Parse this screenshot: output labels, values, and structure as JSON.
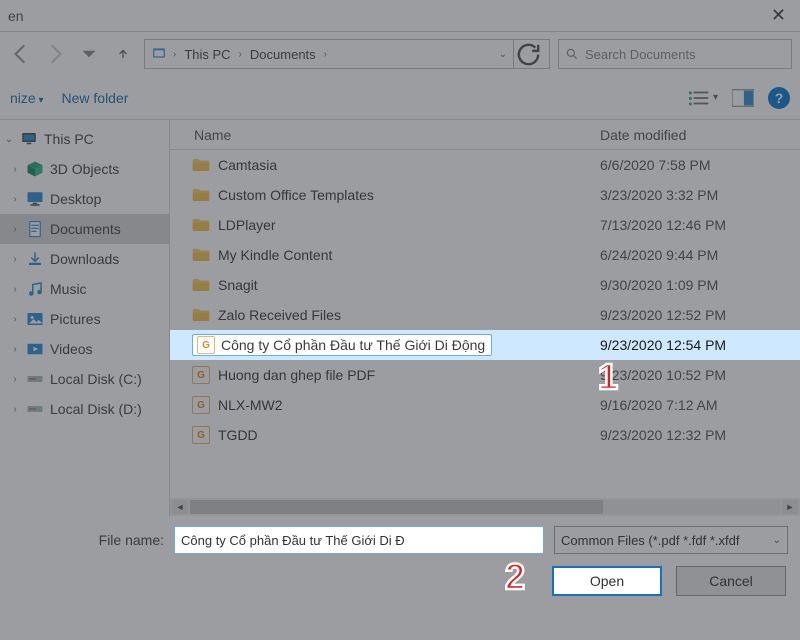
{
  "title": "en",
  "breadcrumb": {
    "items": [
      "This PC",
      "Documents"
    ]
  },
  "search": {
    "placeholder": "Search Documents"
  },
  "toolbar": {
    "organize": "nize",
    "newFolder": "New folder"
  },
  "columns": {
    "name": "Name",
    "date": "Date modified"
  },
  "sidebar": {
    "root": "This PC",
    "items": [
      {
        "label": "3D Objects",
        "icon": "cube"
      },
      {
        "label": "Desktop",
        "icon": "desktop"
      },
      {
        "label": "Documents",
        "icon": "docs",
        "selected": true
      },
      {
        "label": "Downloads",
        "icon": "downloads"
      },
      {
        "label": "Music",
        "icon": "music"
      },
      {
        "label": "Pictures",
        "icon": "pictures"
      },
      {
        "label": "Videos",
        "icon": "videos"
      },
      {
        "label": "Local Disk (C:)",
        "icon": "disk"
      },
      {
        "label": "Local Disk (D:)",
        "icon": "disk"
      }
    ]
  },
  "files": [
    {
      "name": "Camtasia",
      "type": "folder",
      "date": "6/6/2020 7:58 PM"
    },
    {
      "name": "Custom Office Templates",
      "type": "folder",
      "date": "3/23/2020 3:32 PM"
    },
    {
      "name": "LDPlayer",
      "type": "folder",
      "date": "7/13/2020 12:46 PM"
    },
    {
      "name": "My Kindle Content",
      "type": "folder",
      "date": "6/24/2020 9:44 PM"
    },
    {
      "name": "Snagit",
      "type": "folder",
      "date": "9/30/2020 1:09 PM"
    },
    {
      "name": "Zalo Received Files",
      "type": "folder",
      "date": "9/23/2020 12:52 PM"
    },
    {
      "name": "Công ty Cổ phần Đầu tư Thế Giới Di Động",
      "type": "pdf",
      "date": "9/23/2020 12:54 PM",
      "selected": true
    },
    {
      "name": "Huong dan ghep file PDF",
      "type": "pdf",
      "date": "9/23/2020 10:52 PM"
    },
    {
      "name": "NLX-MW2",
      "type": "pdf",
      "date": "9/16/2020 7:12 AM"
    },
    {
      "name": "TGDD",
      "type": "pdf",
      "date": "9/23/2020 12:32 PM"
    }
  ],
  "fileNameLabel": "File name:",
  "fileNameValue": "Công ty Cổ phần Đầu tư Thế Giới Di Đ",
  "filterText": "Common Files (*.pdf *.fdf *.xfdf",
  "buttons": {
    "open": "Open",
    "cancel": "Cancel"
  },
  "callouts": {
    "one": "1",
    "two": "2"
  }
}
